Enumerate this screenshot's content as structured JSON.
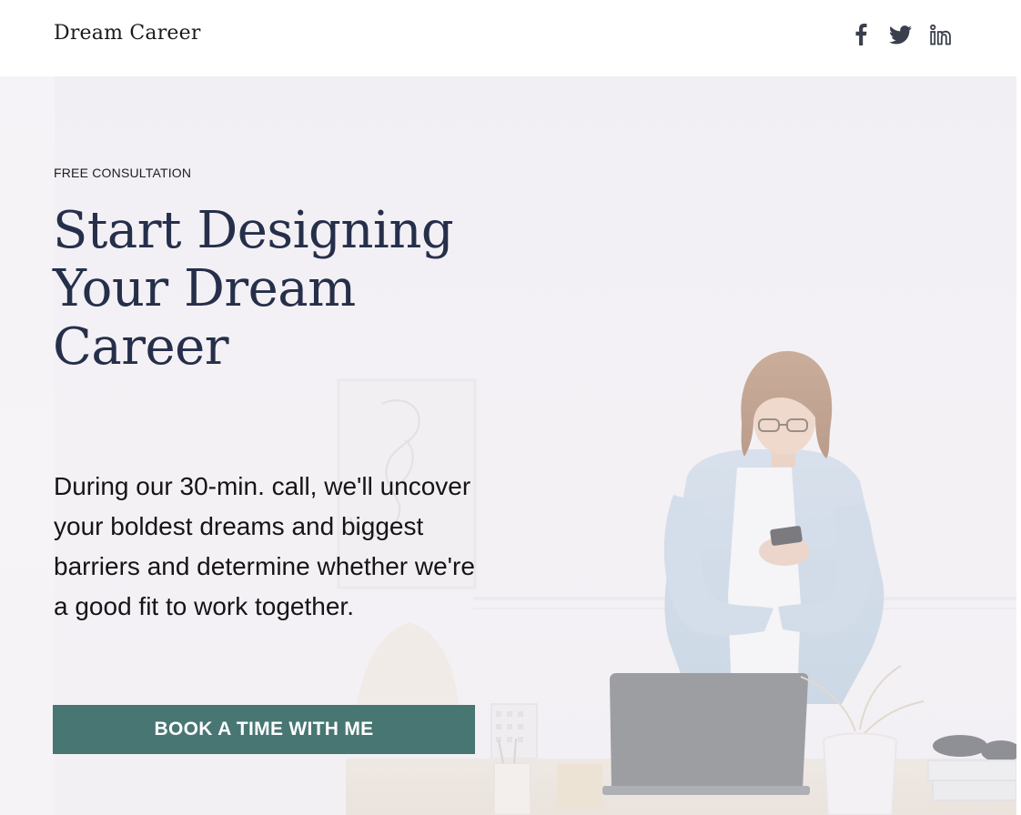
{
  "header": {
    "brand": "Dream Career",
    "social": [
      {
        "name": "facebook-icon"
      },
      {
        "name": "twitter-icon"
      },
      {
        "name": "linkedin-icon"
      }
    ],
    "icon_color": "#3a3f4d"
  },
  "hero": {
    "eyebrow": "FREE CONSULTATION",
    "headline": "Start Designing Your Dream Career",
    "body": "During our 30-min. call, we'll uncover your boldest dreams and biggest barriers and determine whether we're a good fit to work together.",
    "cta_label": "BOOK A TIME WITH ME"
  },
  "colors": {
    "accent": "#477673",
    "headline": "#262f4a",
    "hero_bg": "#f2f0f3"
  }
}
